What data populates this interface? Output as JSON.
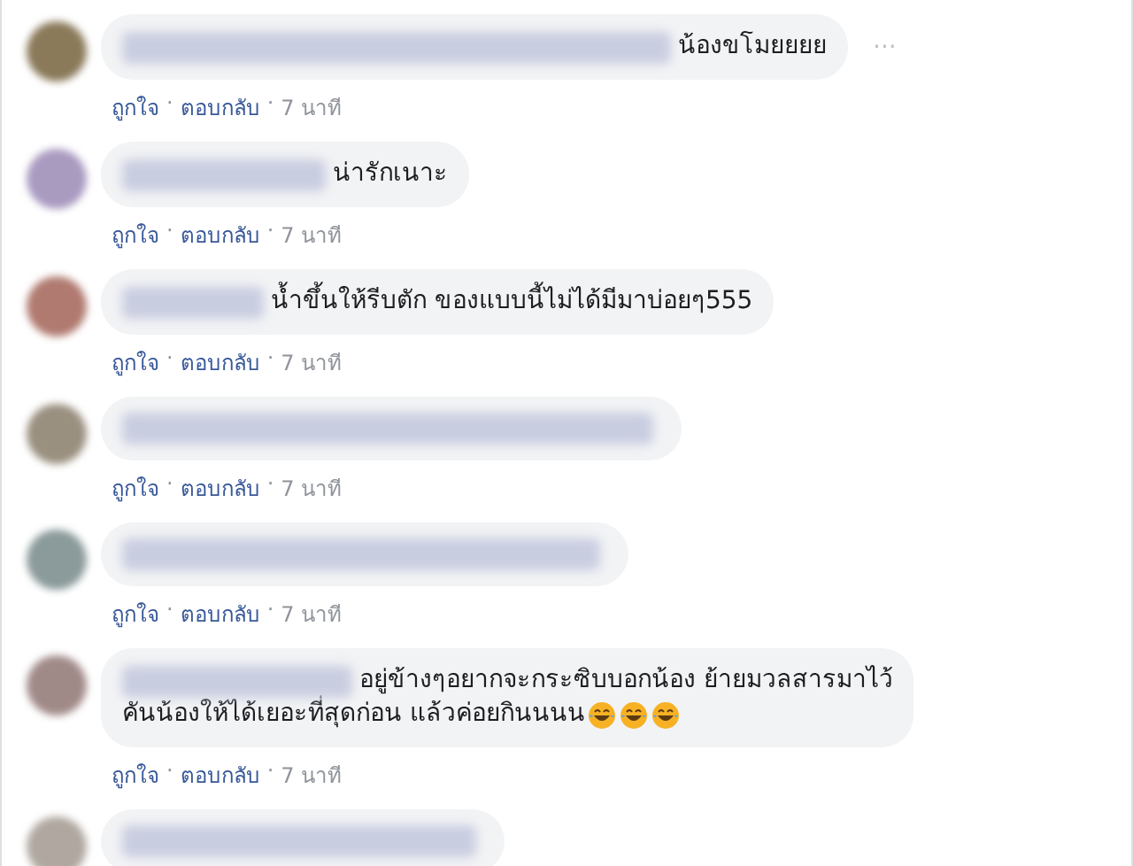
{
  "comments": [
    {
      "kind": "comment",
      "text": "น้องขโมยยยย",
      "menu": "···",
      "like": "ถูกใจ",
      "separator_1": "·",
      "reply": "ตอบกลับ",
      "separator_2": "·",
      "time": "7 นาที"
    },
    {
      "kind": "comment",
      "text": "น่ารักเนาะ",
      "like": "ถูกใจ",
      "separator_1": "·",
      "reply": "ตอบกลับ",
      "separator_2": "·",
      "time": "7 นาที"
    },
    {
      "kind": "comment",
      "text": "น้ำขึ้นให้รีบตัก ของแบบนี้ไม่ได้มีมาบ่อยๆ555",
      "like": "ถูกใจ",
      "separator_1": "·",
      "reply": "ตอบกลับ",
      "separator_2": "·",
      "time": "7 นาที"
    },
    {
      "kind": "comment",
      "like": "ถูกใจ",
      "separator_1": "·",
      "reply": "ตอบกลับ",
      "separator_2": "·",
      "time": "7 นาที"
    },
    {
      "kind": "comment",
      "like": "ถูกใจ",
      "separator_1": "·",
      "reply": "ตอบกลับ",
      "separator_2": "·",
      "time": "7 นาที"
    },
    {
      "kind": "comment",
      "text": "อยู่ข้างๆอยากจะกระซิบบอกน้อง ย้ายมวลสารมาไว้",
      "text_continued": "คันน้องให้ได้เยอะที่สุดก่อน แล้วค่อยกินนนน",
      "emojis": [
        {
          "kind": "tears_of_joy"
        },
        {
          "kind": "tears_of_joy"
        },
        {
          "kind": "tears_of_joy"
        }
      ],
      "like": "ถูกใจ",
      "separator_1": "·",
      "reply": "ตอบกลับ",
      "separator_2": "·",
      "time": "7 นาที"
    },
    {
      "kind": "cut_off"
    }
  ]
}
